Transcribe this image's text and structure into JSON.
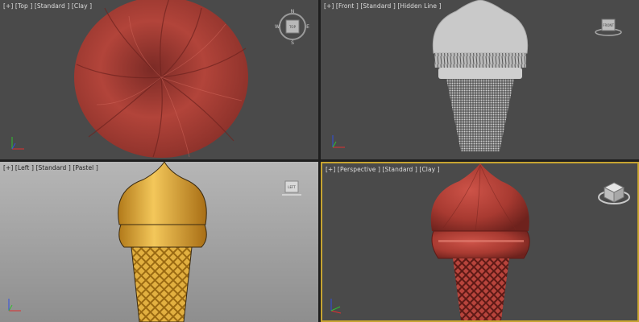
{
  "viewports": {
    "top": {
      "label": "[+] [Top ] [Standard ] [Clay ]"
    },
    "front": {
      "label": "[+] [Front ] [Standard ] [Hidden Line ]"
    },
    "left": {
      "label": "[+] [Left ] [Standard ] [Pastel ]"
    },
    "perspective": {
      "label": "[+] [Perspective ] [Standard ] [Clay ]"
    }
  },
  "viewcube": {
    "top_face": "TOP",
    "front_face": "FRONT",
    "left_face": "LEFT",
    "compass": {
      "n": "N",
      "s": "S",
      "e": "E",
      "w": "W"
    }
  },
  "colors": {
    "active_border": "#c7a431",
    "clay": "#b8443c",
    "pastel": "#e2b040",
    "wire": "#c9c9c9"
  }
}
